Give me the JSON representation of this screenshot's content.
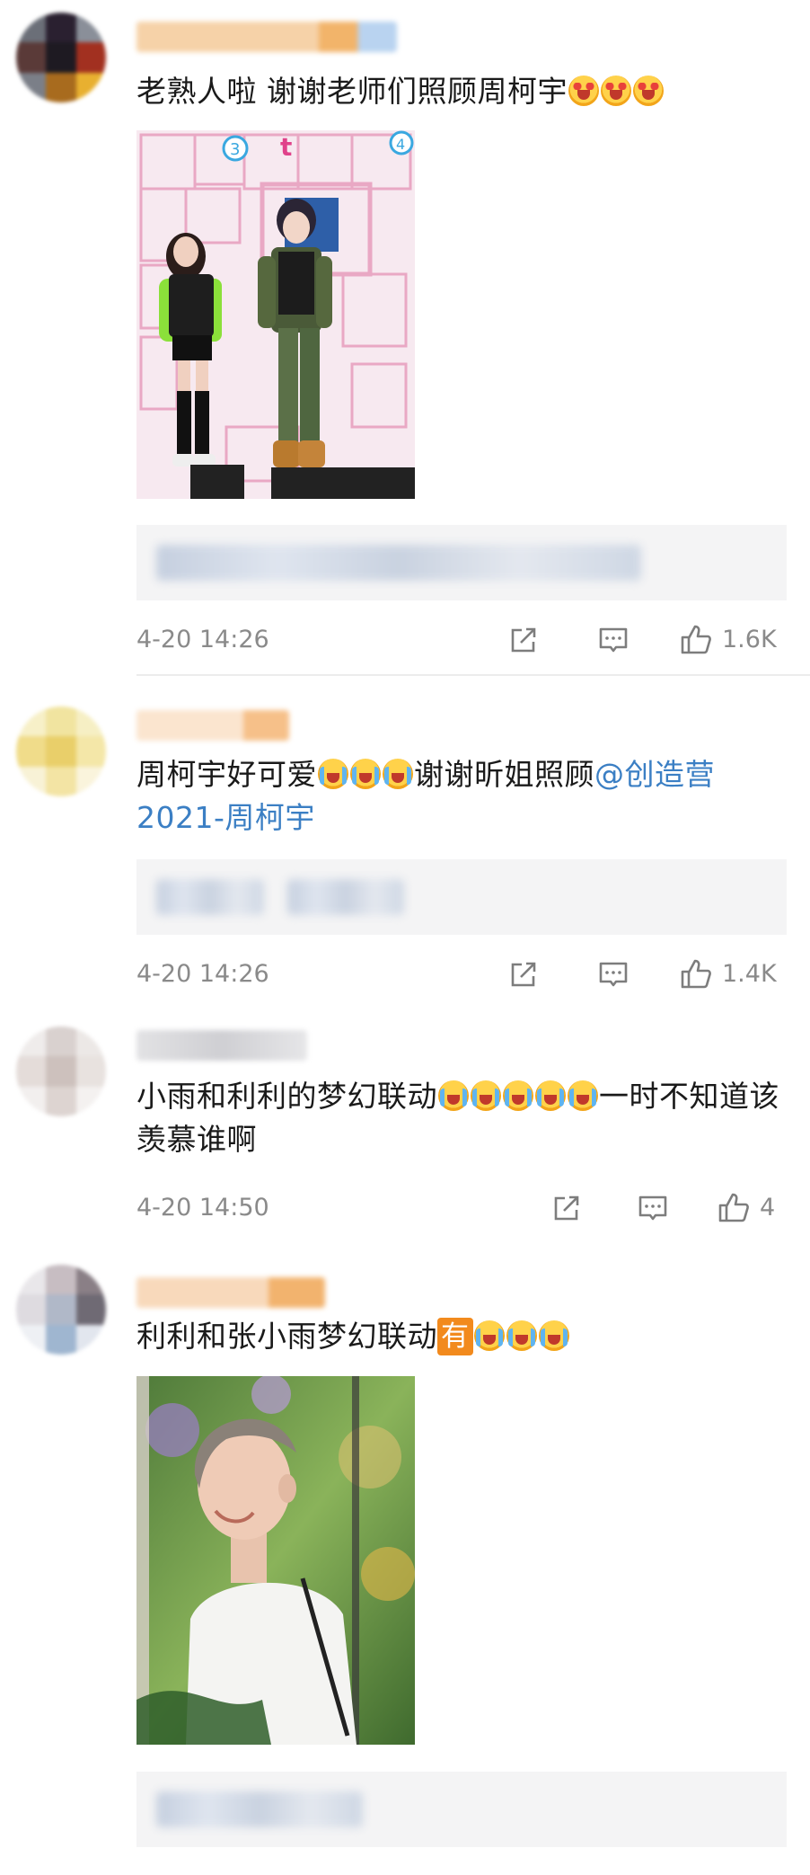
{
  "comments": [
    {
      "text": "老熟人啦 谢谢老师们照顾周柯宇",
      "time": "4-20 14:26",
      "likes": "1.6K"
    },
    {
      "text_before": "周柯宇好可爱",
      "text_middle": "谢谢昕姐照顾",
      "mention": "@创造营2021-周柯宇",
      "time": "4-20 14:26",
      "likes": "1.4K"
    },
    {
      "text_before": "小雨和利利的梦幻联动",
      "text_after": "一时不知道该羡慕谁啊",
      "time": "4-20 14:50",
      "likes": "4"
    },
    {
      "text_before": "利利和张小雨梦幻联动",
      "badge": "有"
    }
  ],
  "icons": {
    "repost": "repost-icon",
    "comment": "comment-icon",
    "like": "thumbs-up-icon",
    "emoji_heart": "heart-eyes-emoji-icon",
    "emoji_cry": "crying-emoji-icon"
  },
  "colors": {
    "mention": "#3b7fc4",
    "meta": "#8a8a8a",
    "badge": "#f28a1d",
    "reply_bg": "#f4f4f5"
  }
}
